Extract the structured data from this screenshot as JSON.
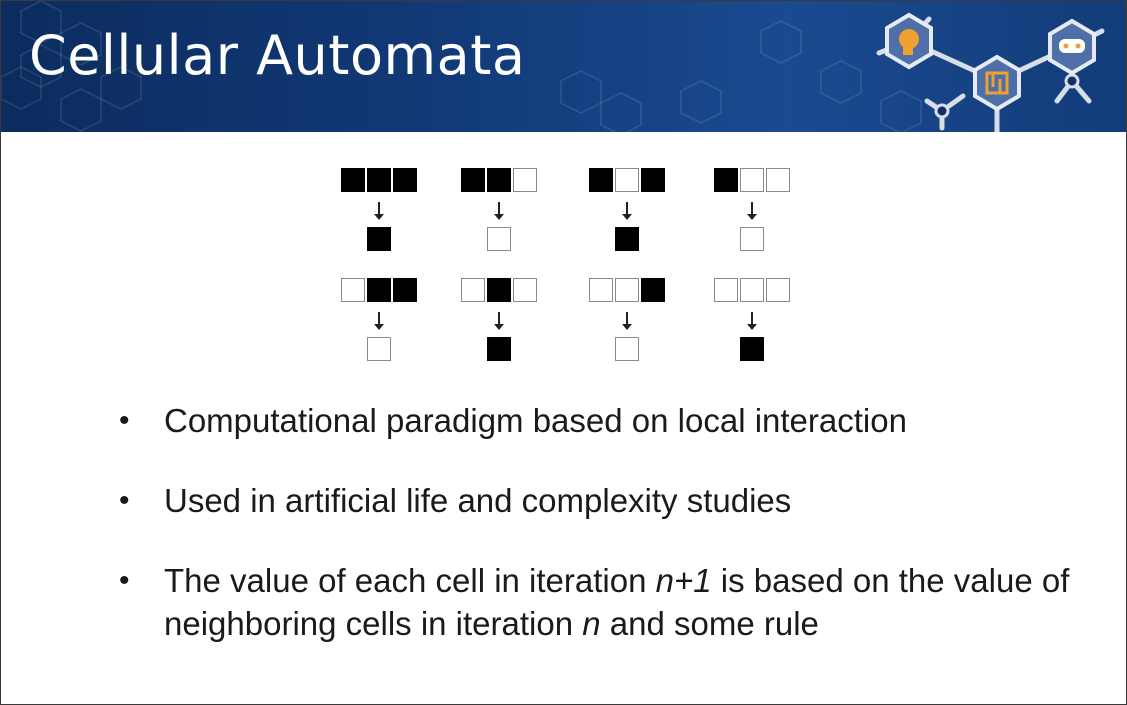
{
  "slide": {
    "title": "Cellular Automata"
  },
  "diagram": {
    "rules": [
      {
        "pattern": [
          1,
          1,
          1
        ],
        "result": 1
      },
      {
        "pattern": [
          1,
          1,
          0
        ],
        "result": 0
      },
      {
        "pattern": [
          1,
          0,
          1
        ],
        "result": 1
      },
      {
        "pattern": [
          1,
          0,
          0
        ],
        "result": 0
      },
      {
        "pattern": [
          0,
          1,
          1
        ],
        "result": 0
      },
      {
        "pattern": [
          0,
          1,
          0
        ],
        "result": 1
      },
      {
        "pattern": [
          0,
          0,
          1
        ],
        "result": 0
      },
      {
        "pattern": [
          0,
          0,
          0
        ],
        "result": 1
      }
    ]
  },
  "bullets": [
    {
      "parts": [
        {
          "text": "Computational paradigm based on local interaction",
          "italic": false
        }
      ]
    },
    {
      "parts": [
        {
          "text": "Used in artificial life and complexity studies",
          "italic": false
        }
      ]
    },
    {
      "parts": [
        {
          "text": "The value of each cell in iteration ",
          "italic": false
        },
        {
          "text": "n+1",
          "italic": true
        },
        {
          "text": " is based on the value of neighboring cells in iteration ",
          "italic": false
        },
        {
          "text": "n",
          "italic": true
        },
        {
          "text": " and some rule",
          "italic": false
        }
      ]
    }
  ],
  "bullet_symbol": "•",
  "colors": {
    "banner": "#123a78",
    "cell_on": "#000000",
    "cell_off": "#ffffff",
    "logo_accent": "#f0a030"
  },
  "icons": [
    "hexagon-pattern-icon",
    "molecule-logo-icon",
    "brain-head-icon",
    "maze-icon",
    "gamepad-icon"
  ]
}
